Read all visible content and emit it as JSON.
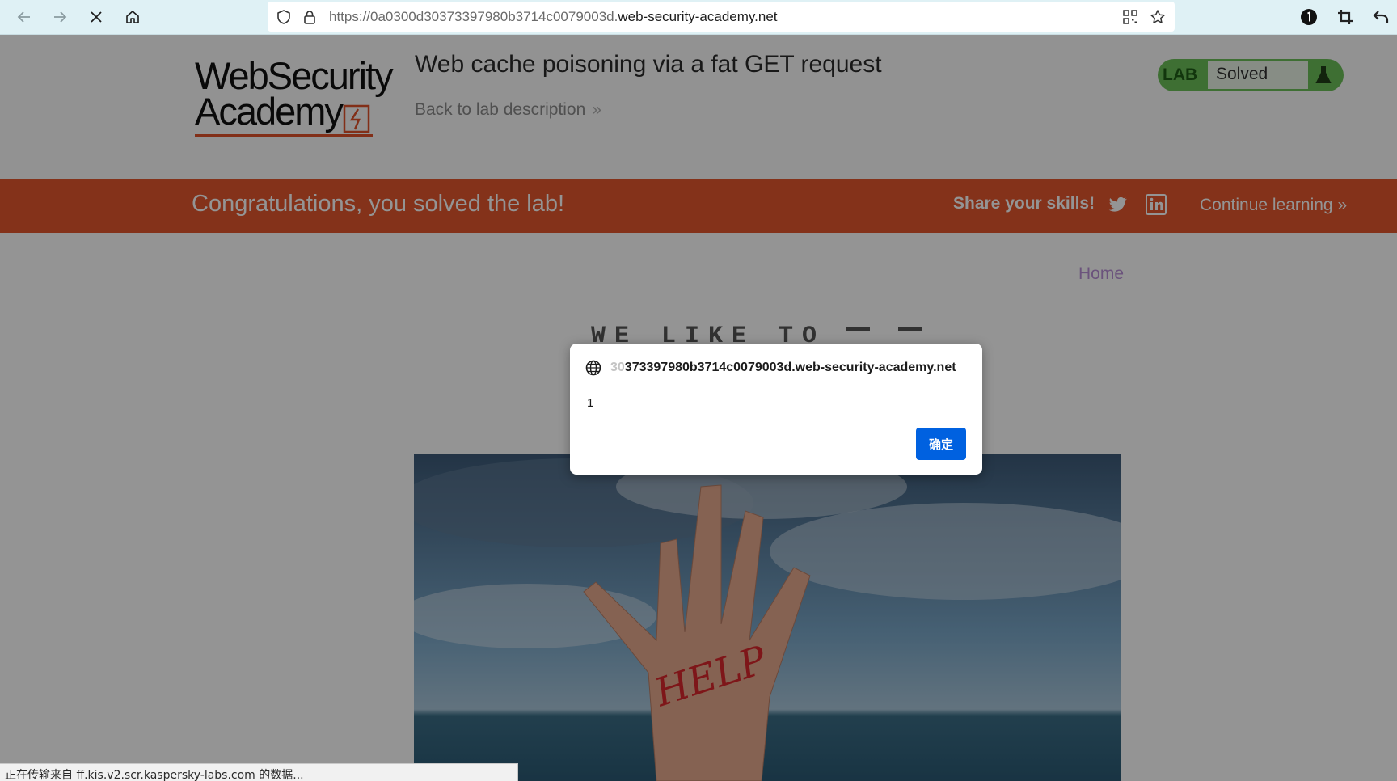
{
  "browser": {
    "url_prefix": "https://0a0300d30373397980b3714c0079003d.",
    "url_domain": "web-security-academy.net",
    "icons": {
      "back": "arrow-left-icon",
      "forward": "arrow-right-icon",
      "stop": "close-icon",
      "home": "home-icon",
      "shield": "shield-icon",
      "lock": "lock-icon",
      "qr": "qr-code-icon",
      "bookmark": "star-icon",
      "extension": "password-manager-icon",
      "screenshot": "crop-icon",
      "undo": "undo-icon"
    }
  },
  "lab": {
    "logo_line1": "WebSecurity",
    "logo_line2": "Academy",
    "title": "Web cache poisoning via a fat GET request",
    "back_link": "Back to lab description",
    "back_chevron": "»",
    "status_tag": "LAB",
    "status_value": "Solved"
  },
  "banner": {
    "congrats": "Congratulations, you solved the lab!",
    "share": "Share your skills!",
    "continue": "Continue learning",
    "continue_chevron": "»",
    "colors": {
      "banner": "#e4572e",
      "lab_badge": "#6cbf59"
    }
  },
  "blog": {
    "home_link": "Home",
    "heading": "WE LIKE TO"
  },
  "dialog": {
    "origin_faded": "30",
    "origin": "373397980b3714c0079003d.web-security-academy.net",
    "message": "1",
    "ok_label": "确定",
    "accent": "#0061e0"
  },
  "statusbar": {
    "text": "正在传输来自 ff.kis.v2.scr.kaspersky-labs.com 的数据..."
  }
}
